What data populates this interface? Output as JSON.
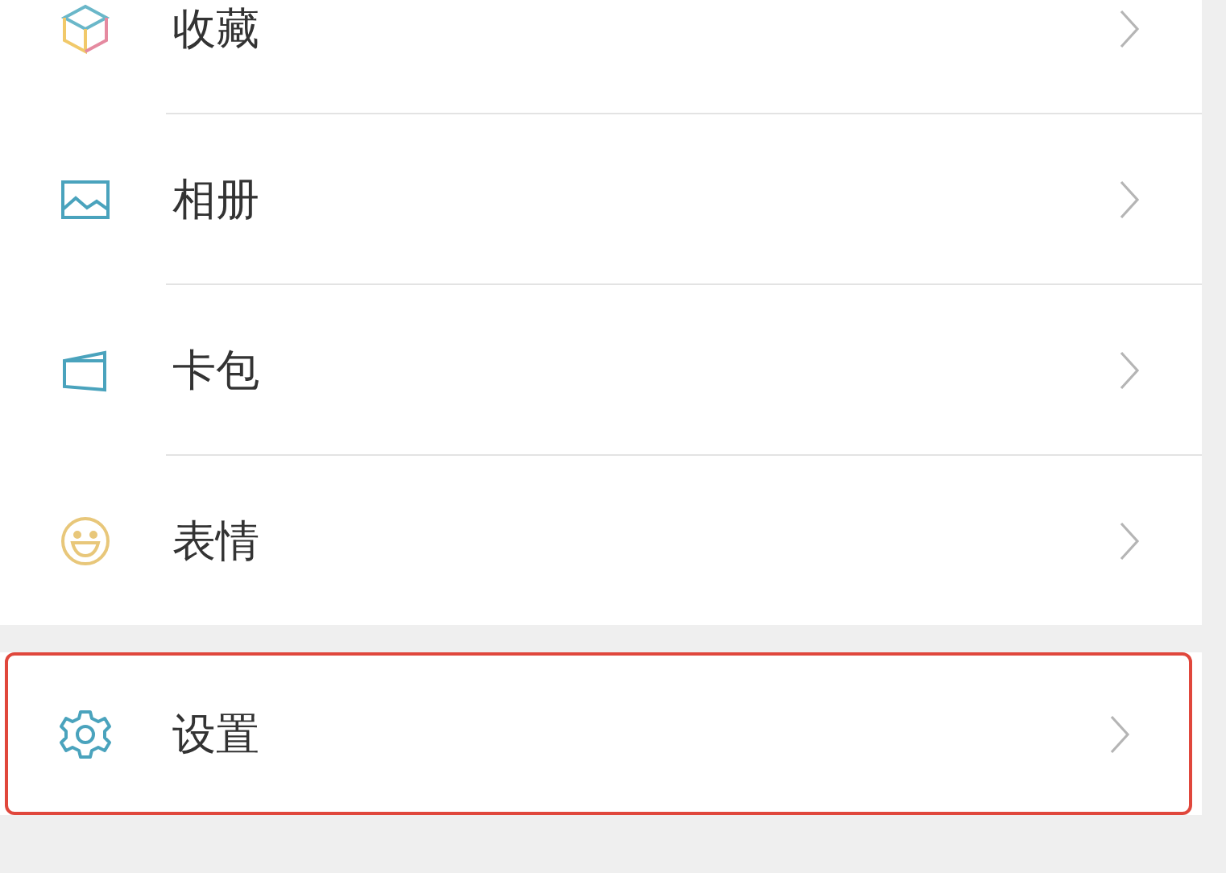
{
  "groups": [
    {
      "items": [
        {
          "kind": "cube",
          "label": "收藏",
          "highlighted": false
        },
        {
          "kind": "image",
          "label": "相册",
          "highlighted": false
        },
        {
          "kind": "card",
          "label": "卡包",
          "highlighted": false
        },
        {
          "kind": "smile",
          "label": "表情",
          "highlighted": false
        }
      ]
    },
    {
      "items": [
        {
          "kind": "gear",
          "label": "设置",
          "highlighted": true
        }
      ]
    }
  ]
}
